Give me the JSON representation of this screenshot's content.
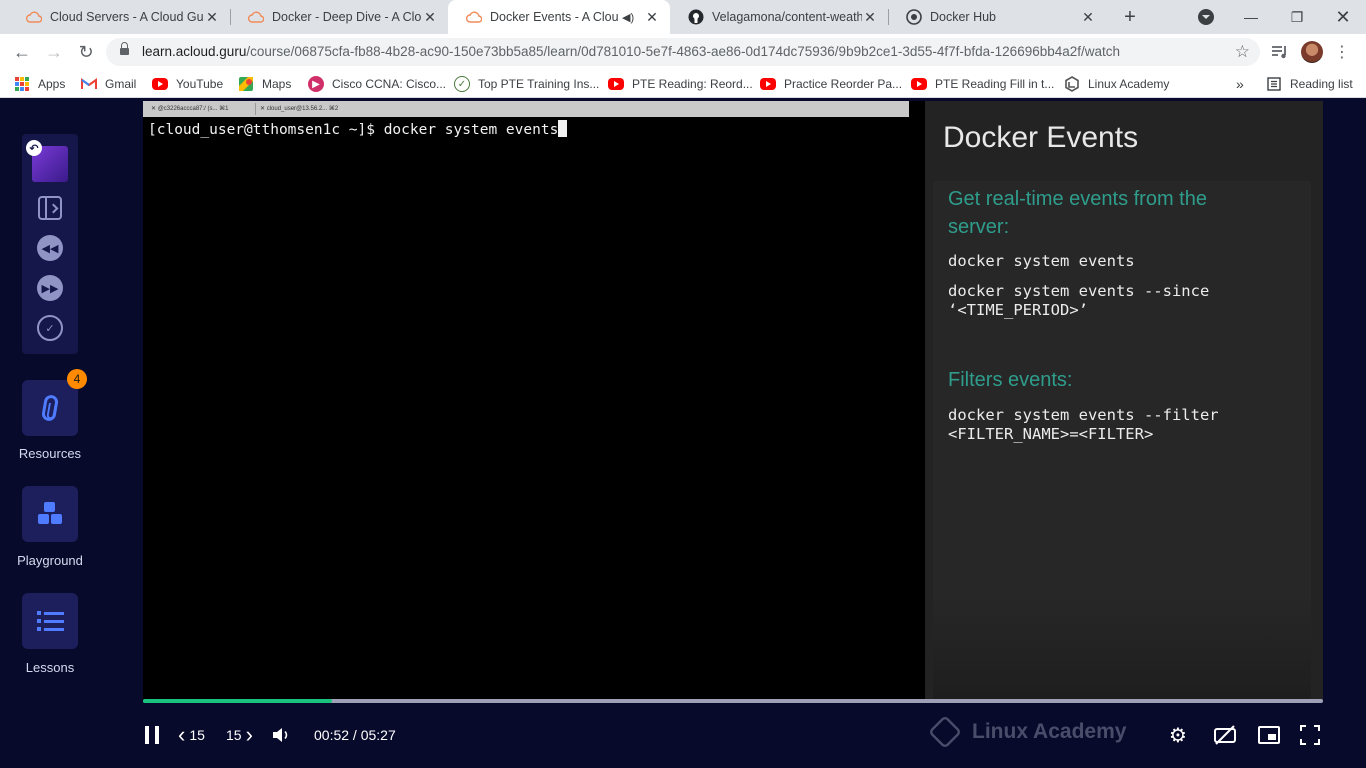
{
  "browser": {
    "tabs": [
      {
        "title": "Cloud Servers - A Cloud Guru",
        "icon": "cloud-icon",
        "active": false
      },
      {
        "title": "Docker - Deep Dive - A Cloud",
        "icon": "cloud-icon",
        "active": false
      },
      {
        "title": "Docker Events - A Cloud",
        "icon": "cloud-icon",
        "active": true,
        "audio": true
      },
      {
        "title": "Velagamona/content-weathe",
        "icon": "github-icon",
        "active": false
      },
      {
        "title": "Docker Hub",
        "icon": "docker-hub-icon",
        "active": false
      }
    ],
    "url_host": "learn.acloud.guru",
    "url_path": "/course/06875cfa-fb88-4b28-ac90-150e73bb5a85/learn/0d781010-5e7f-4863-ae86-0d174dc75936/9b9b2ce1-3d55-4f7f-bfda-126696bb4a2f/watch",
    "bookmarks": [
      {
        "label": "Apps",
        "icon": "apps-grid-icon"
      },
      {
        "label": "Gmail",
        "icon": "gmail-icon"
      },
      {
        "label": "YouTube",
        "icon": "youtube-icon"
      },
      {
        "label": "Maps",
        "icon": "maps-icon"
      },
      {
        "label": "Cisco CCNA: Cisco...",
        "icon": "cisco-icon"
      },
      {
        "label": "Top PTE Training Ins...",
        "icon": "pte-icon"
      },
      {
        "label": "PTE Reading: Reord...",
        "icon": "youtube-icon"
      },
      {
        "label": "Practice Reorder Pa...",
        "icon": "youtube-icon"
      },
      {
        "label": "PTE Reading Fill in t...",
        "icon": "youtube-icon"
      },
      {
        "label": "Linux Academy",
        "icon": "linux-academy-icon"
      }
    ],
    "bookmarks_overflow": "»",
    "reading_list": "Reading list"
  },
  "sidebar": {
    "resources_label": "Resources",
    "resources_badge": "4",
    "playground_label": "Playground",
    "lessons_label": "Lessons"
  },
  "video": {
    "terminal_tabs": [
      "@c3226accca87:/ (s... ⌘1",
      "cloud_user@13.56.2... ⌘2"
    ],
    "terminal_line": "[cloud_user@tthomsen1c ~]$ docker system events",
    "slide": {
      "title": "Docker Events",
      "heading1_line1": "Get real-time events from the",
      "heading1_line2": "server:",
      "code1": "docker system events",
      "code2_line1": "docker system events --since",
      "code2_line2": "‘<TIME_PERIOD>’",
      "heading2": "Filters events:",
      "code3_line1": "docker system events --filter",
      "code3_line2": "<FILTER_NAME>=<FILTER>"
    },
    "watermark": "Linux Academy"
  },
  "player": {
    "progress": 0.16,
    "back_seconds": "15",
    "forward_seconds": "15",
    "time_display": "00:52 / 05:27",
    "colors": {
      "progress_fill": "#19c37d",
      "progress_track": "#9ea0b8"
    }
  }
}
